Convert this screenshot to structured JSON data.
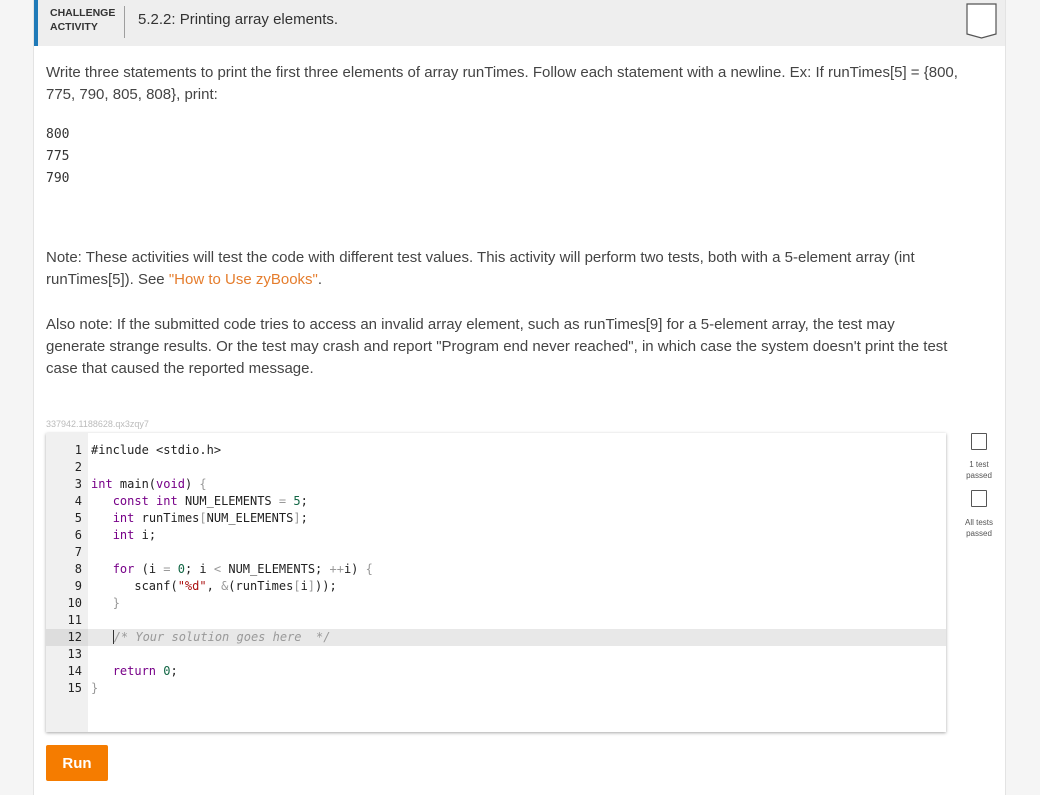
{
  "header": {
    "activity_type": "CHALLENGE\nACTIVITY",
    "title": "5.2.2: Printing array elements."
  },
  "prompt": {
    "text": "Write three statements to print the first three elements of array runTimes. Follow each statement with a newline. Ex: If runTimes[5] = {800, 775, 790, 805, 808}, print:",
    "sample_output": [
      "800",
      "775",
      "790"
    ]
  },
  "note": {
    "text": "Note: These activities will test the code with different test values. This activity will perform two tests, both with a 5-element array (int runTimes[5]). See ",
    "link": "\"How to Use zyBooks\"",
    "end": "."
  },
  "also_note": "Also note: If the submitted code tries to access an invalid array element, such as runTimes[9] for a 5-element array, the test may generate strange results. Or the test may crash and report \"Program end never reached\", in which case the system doesn't print the test case that caused the reported message.",
  "activity_id": "337942.1188628.qx3zqy7",
  "code": {
    "line_numbers": [
      "1",
      "2",
      "3",
      "4",
      "5",
      "6",
      "7",
      "8",
      "9",
      "10",
      "11",
      "12",
      "13",
      "14",
      "15"
    ],
    "line1": "#include <stdio.h>",
    "active_line": 12
  },
  "tests": {
    "one_test_label": "1 test\npassed",
    "all_tests_label": "All tests\npassed"
  },
  "run_button": "Run"
}
